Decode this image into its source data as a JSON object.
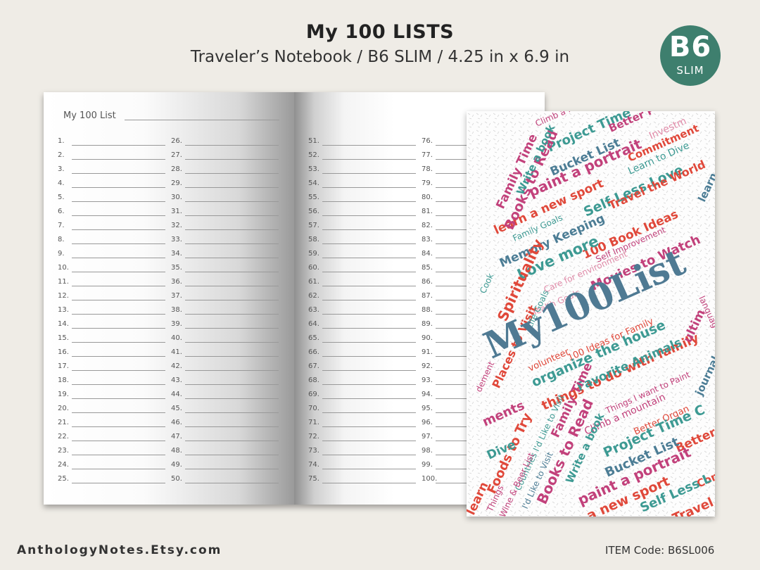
{
  "header": {
    "title": "My 100 LISTS",
    "subtitle": "Traveler’s Notebook / B6 SLIM / 4.25 in x 6.9 in"
  },
  "badge": {
    "size": "B6",
    "label": "SLIM",
    "color": "#3e7f6e"
  },
  "notebook": {
    "page_title": "My 100 List",
    "numbers": [
      "1.",
      "2.",
      "3.",
      "4.",
      "5.",
      "6.",
      "7.",
      "8.",
      "9.",
      "10.",
      "11.",
      "12.",
      "13.",
      "14.",
      "15.",
      "16.",
      "17.",
      "18.",
      "19.",
      "20.",
      "21.",
      "22.",
      "23.",
      "24.",
      "25.",
      "26.",
      "27.",
      "28.",
      "29.",
      "30.",
      "31.",
      "32.",
      "33.",
      "34.",
      "35.",
      "36.",
      "37.",
      "38.",
      "39.",
      "40.",
      "41.",
      "42.",
      "43.",
      "44.",
      "45.",
      "46.",
      "47.",
      "48.",
      "49.",
      "50.",
      "51.",
      "52.",
      "53.",
      "54.",
      "55.",
      "56.",
      "57.",
      "58.",
      "59.",
      "60.",
      "61.",
      "62.",
      "63.",
      "64.",
      "65.",
      "66.",
      "67.",
      "68.",
      "69.",
      "70.",
      "71.",
      "72.",
      "73.",
      "74.",
      "75.",
      "76.",
      "77.",
      "78.",
      "79.",
      "80.",
      "81.",
      "82.",
      "83.",
      "84.",
      "85.",
      "86.",
      "87.",
      "88.",
      "89.",
      "90.",
      "91.",
      "92.",
      "93.",
      "94.",
      "95.",
      "96.",
      "97.",
      "98.",
      "99.",
      "100."
    ]
  },
  "cover": {
    "title": "My100List",
    "colors": {
      "teal": "#3d9a93",
      "red": "#e0483a",
      "pink": "#c2417b",
      "blue": "#4c7d95",
      "lightpink": "#e08aa8",
      "title": "#4f7a93"
    },
    "words": [
      {
        "t": "Project Time",
        "c": "teal"
      },
      {
        "t": "Better P",
        "c": "pink"
      },
      {
        "t": "Climb a m",
        "c": "pink"
      },
      {
        "t": "Investm",
        "c": "lightpink"
      },
      {
        "t": "Bucket List",
        "c": "blue"
      },
      {
        "t": "Learn to Dive",
        "c": "teal"
      },
      {
        "t": "paint a portrait",
        "c": "pink"
      },
      {
        "t": "Commitment",
        "c": "red"
      },
      {
        "t": "learn a new sport",
        "c": "red"
      },
      {
        "t": "Self Less Love",
        "c": "teal"
      },
      {
        "t": "Travel the World",
        "c": "red"
      },
      {
        "t": "Family Goals",
        "c": "teal"
      },
      {
        "t": "Memory Keeping",
        "c": "blue"
      },
      {
        "t": "100 Book Ideas",
        "c": "red"
      },
      {
        "t": "Self Improvement",
        "c": "pink"
      },
      {
        "t": "Love more",
        "c": "teal"
      },
      {
        "t": "Movies to Watch",
        "c": "pink"
      },
      {
        "t": "Care for environment",
        "c": "lightpink"
      },
      {
        "t": "Health Goals",
        "c": "lightpink"
      },
      {
        "t": "volunteer",
        "c": "red"
      },
      {
        "t": "100 Ideas for Family",
        "c": "red"
      },
      {
        "t": "organize the house",
        "c": "teal"
      },
      {
        "t": "things to do with family",
        "c": "red"
      },
      {
        "t": "Favorite Animals",
        "c": "teal"
      },
      {
        "t": "Things I want to Paint",
        "c": "pink"
      },
      {
        "t": "Climb a mountain",
        "c": "pink"
      },
      {
        "t": "Better Organ",
        "c": "red"
      },
      {
        "t": "Project Time C",
        "c": "teal"
      },
      {
        "t": "Better",
        "c": "red"
      },
      {
        "t": "Bucket List",
        "c": "blue"
      },
      {
        "t": "paint a portrait",
        "c": "pink"
      },
      {
        "t": "n a new sport",
        "c": "red"
      },
      {
        "t": "Com",
        "c": "red"
      },
      {
        "t": "Self Less L",
        "c": "teal"
      },
      {
        "t": "Travel th",
        "c": "red"
      },
      {
        "t": "Family Time",
        "c": "pink"
      },
      {
        "t": "Books to Read",
        "c": "pink"
      },
      {
        "t": "Write a book",
        "c": "teal"
      },
      {
        "t": "Spirituality",
        "c": "red"
      },
      {
        "t": "Places to Visit",
        "c": "red"
      },
      {
        "t": "journal everyday",
        "c": "blue"
      },
      {
        "t": "Life Goals",
        "c": "teal"
      },
      {
        "t": "Cook",
        "c": "teal"
      },
      {
        "t": "Family Time",
        "c": "pink"
      },
      {
        "t": "Books to Read",
        "c": "pink"
      },
      {
        "t": "Write a book",
        "c": "teal"
      },
      {
        "t": "Foods to Try",
        "c": "red"
      },
      {
        "t": "Countries I'd Like to Visit",
        "c": "teal"
      },
      {
        "t": "Wine & Beer List",
        "c": "pink"
      },
      {
        "t": "Things",
        "c": "pink"
      },
      {
        "t": "I'd Like to Visit",
        "c": "blue"
      },
      {
        "t": "ments",
        "c": "pink"
      },
      {
        "t": "Dive",
        "c": "teal"
      },
      {
        "t": "learn",
        "c": "red"
      },
      {
        "t": "ultim",
        "c": "pink"
      },
      {
        "t": "languag",
        "c": "pink"
      },
      {
        "t": "dement",
        "c": "pink"
      },
      {
        "t": "learn",
        "c": "blue"
      }
    ]
  },
  "footer": {
    "shop": "AnthologyNotes.Etsy.com",
    "item_code": "ITEM Code: B6SL006"
  }
}
